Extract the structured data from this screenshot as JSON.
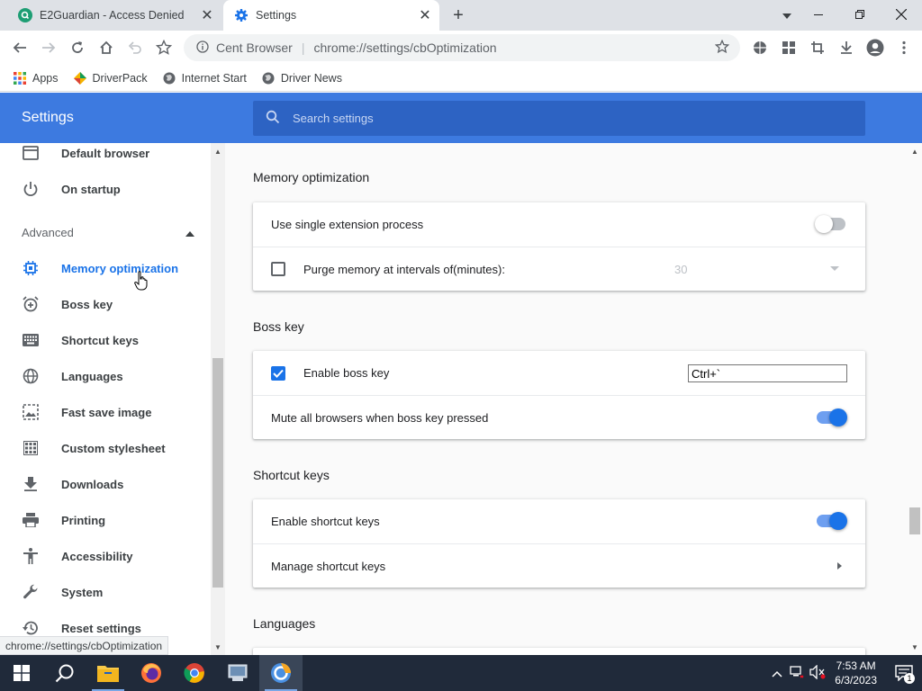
{
  "tabs": [
    {
      "title": "E2Guardian - Access Denied",
      "active": false,
      "icon": "search-favicon"
    },
    {
      "title": "Settings",
      "active": true,
      "icon": "gear-favicon"
    }
  ],
  "window_controls": {
    "minimize": "minimize-icon",
    "restore": "restore-icon",
    "close": "close-icon"
  },
  "omnibox": {
    "site_name": "Cent Browser",
    "url": "chrome://settings/cbOptimization"
  },
  "bookmarks": [
    {
      "label": "Apps",
      "icon": "apps-grid-icon"
    },
    {
      "label": "DriverPack",
      "icon": "driverpack-icon"
    },
    {
      "label": "Internet Start",
      "icon": "globe-icon"
    },
    {
      "label": "Driver News",
      "icon": "globe-icon"
    }
  ],
  "settings": {
    "title": "Settings",
    "search_placeholder": "Search settings"
  },
  "sidebar": {
    "items_top": [
      {
        "label": "Default browser",
        "icon": "browser-window-icon"
      },
      {
        "label": "On startup",
        "icon": "power-icon"
      }
    ],
    "advanced_label": "Advanced",
    "items_advanced": [
      {
        "label": "Memory optimization",
        "icon": "chip-icon",
        "active": true
      },
      {
        "label": "Boss key",
        "icon": "alarm-icon"
      },
      {
        "label": "Shortcut keys",
        "icon": "keyboard-icon"
      },
      {
        "label": "Languages",
        "icon": "globe-icon"
      },
      {
        "label": "Fast save image",
        "icon": "image-icon"
      },
      {
        "label": "Custom stylesheet",
        "icon": "grid-icon"
      },
      {
        "label": "Downloads",
        "icon": "download-icon"
      },
      {
        "label": "Printing",
        "icon": "printer-icon"
      },
      {
        "label": "Accessibility",
        "icon": "accessibility-icon"
      },
      {
        "label": "System",
        "icon": "wrench-icon"
      },
      {
        "label": "Reset settings",
        "icon": "history-icon"
      }
    ]
  },
  "sections": {
    "memory": {
      "title": "Memory optimization",
      "single_extension_label": "Use single extension process",
      "single_extension_on": false,
      "purge_label": "Purge memory at intervals of(minutes):",
      "purge_checked": false,
      "purge_value": "30"
    },
    "boss_key": {
      "title": "Boss key",
      "enable_label": "Enable boss key",
      "enable_checked": true,
      "key_value": "Ctrl+`",
      "mute_label": "Mute all browsers when boss key pressed",
      "mute_on": true
    },
    "shortcut_keys": {
      "title": "Shortcut keys",
      "enable_label": "Enable shortcut keys",
      "enable_on": true,
      "manage_label": "Manage shortcut keys"
    },
    "languages": {
      "title": "Languages"
    }
  },
  "status_bubble": "chrome://settings/cbOptimization",
  "taskbar": {
    "time": "7:53 AM",
    "date": "6/3/2023",
    "notification_count": "1"
  },
  "colors": {
    "accent": "#1a73e8",
    "header_blue": "#3d7ae0"
  }
}
